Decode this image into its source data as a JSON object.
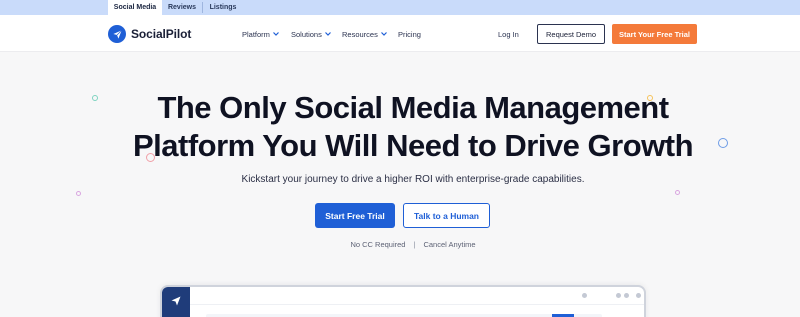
{
  "topbar": {
    "tabs": [
      {
        "label": "Social Media",
        "active": true
      },
      {
        "label": "Reviews",
        "active": false
      },
      {
        "label": "Listings",
        "active": false
      }
    ]
  },
  "nav": {
    "brand": "SocialPilot",
    "menu": [
      {
        "label": "Platform",
        "dropdown": true
      },
      {
        "label": "Solutions",
        "dropdown": true
      },
      {
        "label": "Resources",
        "dropdown": true
      },
      {
        "label": "Pricing",
        "dropdown": false
      }
    ],
    "login_label": "Log In",
    "demo_label": "Request Demo",
    "trial_label": "Start Your Free Trial"
  },
  "hero": {
    "headline_line1": "The Only Social Media Management",
    "headline_line2": "Platform You Will Need to Drive Growth",
    "subheadline": "Kickstart your journey to drive a higher ROI with enterprise-grade capabilities.",
    "primary_cta": "Start Free Trial",
    "secondary_cta": "Talk to a Human",
    "note_1": "No CC Required",
    "note_divider": "|",
    "note_2": "Cancel Anytime"
  },
  "colors": {
    "brand_blue": "#1f5fd6",
    "accent_orange": "#f47a3a",
    "topbar_bg": "#c9dbfa",
    "text_dark": "#0f1222"
  },
  "icons": {
    "logo": "paper-plane-icon",
    "chevron": "chevron-down-icon"
  }
}
